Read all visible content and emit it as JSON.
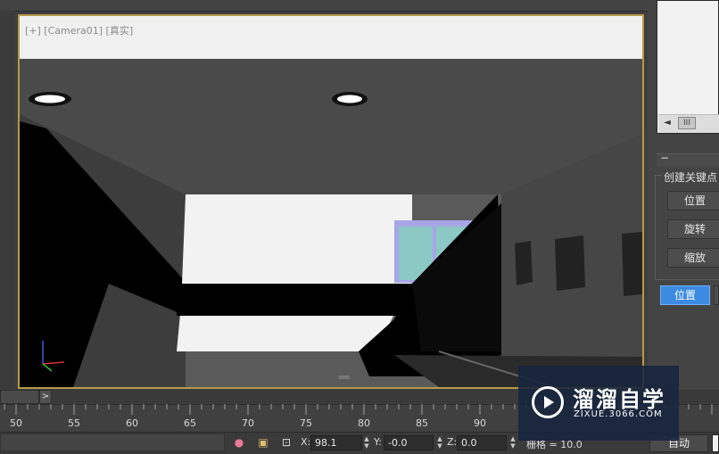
{
  "viewport": {
    "label": "[+] [Camera01] [真实]"
  },
  "right_panel": {
    "list_scroll_thumb": "III",
    "list_scroll_left": "◄",
    "rollout_toggle": "−",
    "group_title": "创建关键点",
    "buttons": {
      "position": "位置",
      "rotate": "旋转",
      "scale": "缩放"
    },
    "key_button": "位置"
  },
  "time_slider": {
    "next_label": ">"
  },
  "ruler": {
    "labels": [
      "50",
      "55",
      "60",
      "65",
      "70",
      "75",
      "80",
      "85",
      "90"
    ]
  },
  "status_bar": {
    "x_label": "X:",
    "x_value": "98.1",
    "y_label": "Y:",
    "y_value": "-0.0",
    "z_label": "Z:",
    "z_value": "0.0",
    "grid_label": "栅格 = 10.0",
    "auto_key": "自动"
  },
  "watermark": {
    "title": "溜溜自学",
    "url": "ZIXUE.3066.COM"
  },
  "colors": {
    "viewport_border": "#b79a4a",
    "active_button": "#3d8be0",
    "window_glass": "#8cc8c4",
    "window_frame": "#a8a6e6"
  }
}
